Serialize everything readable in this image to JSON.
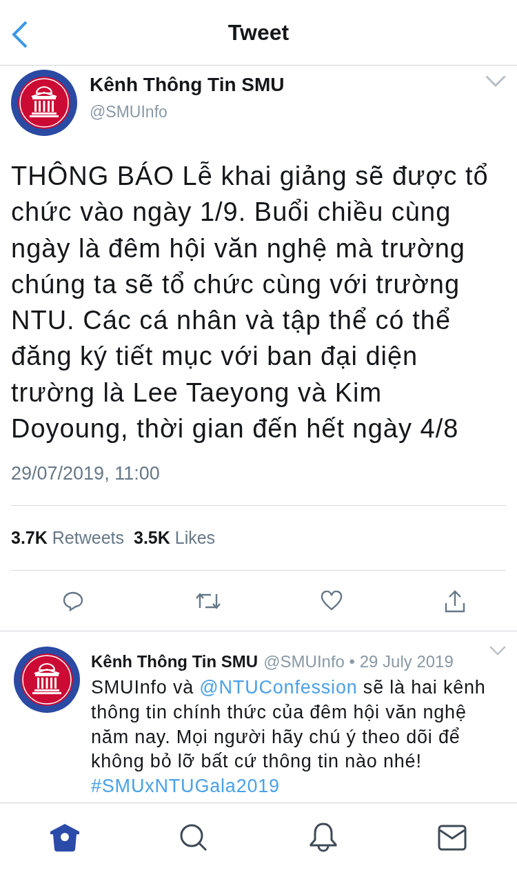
{
  "header": {
    "title": "Tweet"
  },
  "tweet": {
    "name": "Kênh Thông Tin SMU",
    "handle": "@SMUInfo",
    "text": "THÔNG BÁO Lễ khai giảng sẽ được tổ chức vào ngày 1/9. Buổi chiều cùng ngày là đêm hội văn nghệ mà trường chúng ta sẽ tổ chức cùng với trường NTU. Các cá nhân và tập thể có thể đăng ký tiết mục với ban đại diện trường là Lee Taeyong và Kim Doyoung, thời gian đến hết ngày 4/8",
    "timestamp": "29/07/2019, 11:00",
    "stats": [
      {
        "count": "3.7K",
        "label": "Retweets"
      },
      {
        "count": "3.5K",
        "label": "Likes"
      }
    ],
    "actions": [
      {
        "kind": "reply"
      },
      {
        "kind": "retweet"
      },
      {
        "kind": "like"
      },
      {
        "kind": "share"
      }
    ]
  },
  "reply": {
    "name": "Kênh Thông Tin SMU",
    "meta": "@SMUInfo • 29 July 2019",
    "segments": [
      {
        "kind": "plain",
        "text": "SMUInfo và "
      },
      {
        "kind": "mention",
        "text": "@NTUConfession"
      },
      {
        "kind": "plain",
        "text": " sẽ là hai kênh thông tin chính thức của đêm hội văn nghệ năm nay. Mọi người hãy chú ý theo dõi để không bỏ lỡ bất cứ thông tin nào nhé! "
      },
      {
        "kind": "hashtag",
        "text": "#SMUxNTUGala2019"
      }
    ]
  },
  "tab_bar": [
    {
      "kind": "home",
      "selected": true
    },
    {
      "kind": "search",
      "selected": false
    },
    {
      "kind": "notifications",
      "selected": false
    },
    {
      "kind": "messages",
      "selected": false
    }
  ]
}
